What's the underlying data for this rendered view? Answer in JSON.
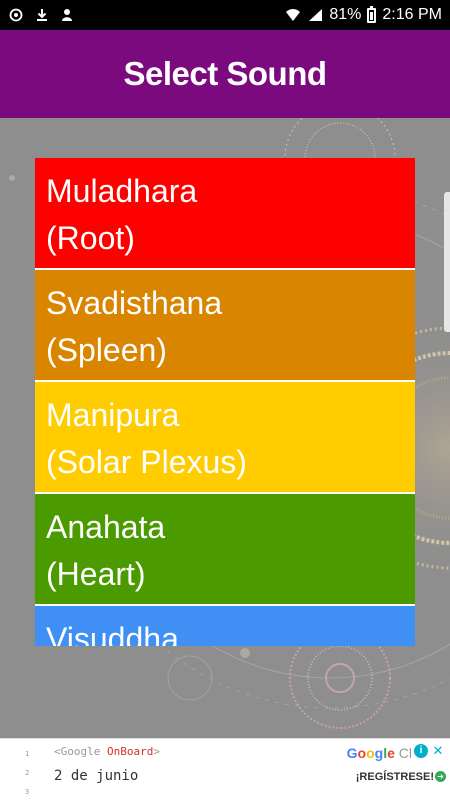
{
  "status_bar": {
    "battery": "81%",
    "time": "2:16 PM",
    "icons": [
      "sync-icon",
      "download-icon",
      "person-icon",
      "wifi-icon",
      "signal-icon",
      "battery-icon"
    ]
  },
  "header": {
    "title": "Select Sound",
    "background": "#7a0a7e"
  },
  "sound_list": {
    "items": [
      {
        "name": "Muladhara",
        "sub": "(Root)",
        "color": "#ff0000"
      },
      {
        "name": "Svadisthana",
        "sub": "(Spleen)",
        "color": "#d98500"
      },
      {
        "name": "Manipura",
        "sub": "(Solar Plexus)",
        "color": "#ffcc00"
      },
      {
        "name": "Anahata",
        "sub": "(Heart)",
        "color": "#4b9b00"
      },
      {
        "name": "Visuddha",
        "sub": "",
        "color": "#3f8ff5"
      }
    ]
  },
  "ad": {
    "line_numbers": [
      "1",
      "2",
      "3"
    ],
    "code_prefix": "<Google ",
    "code_highlight": "OnBoard",
    "code_suffix": ">",
    "date": "2 de junio",
    "brand": "Google Cl",
    "cta": "¡REGÍSTRESE!"
  }
}
